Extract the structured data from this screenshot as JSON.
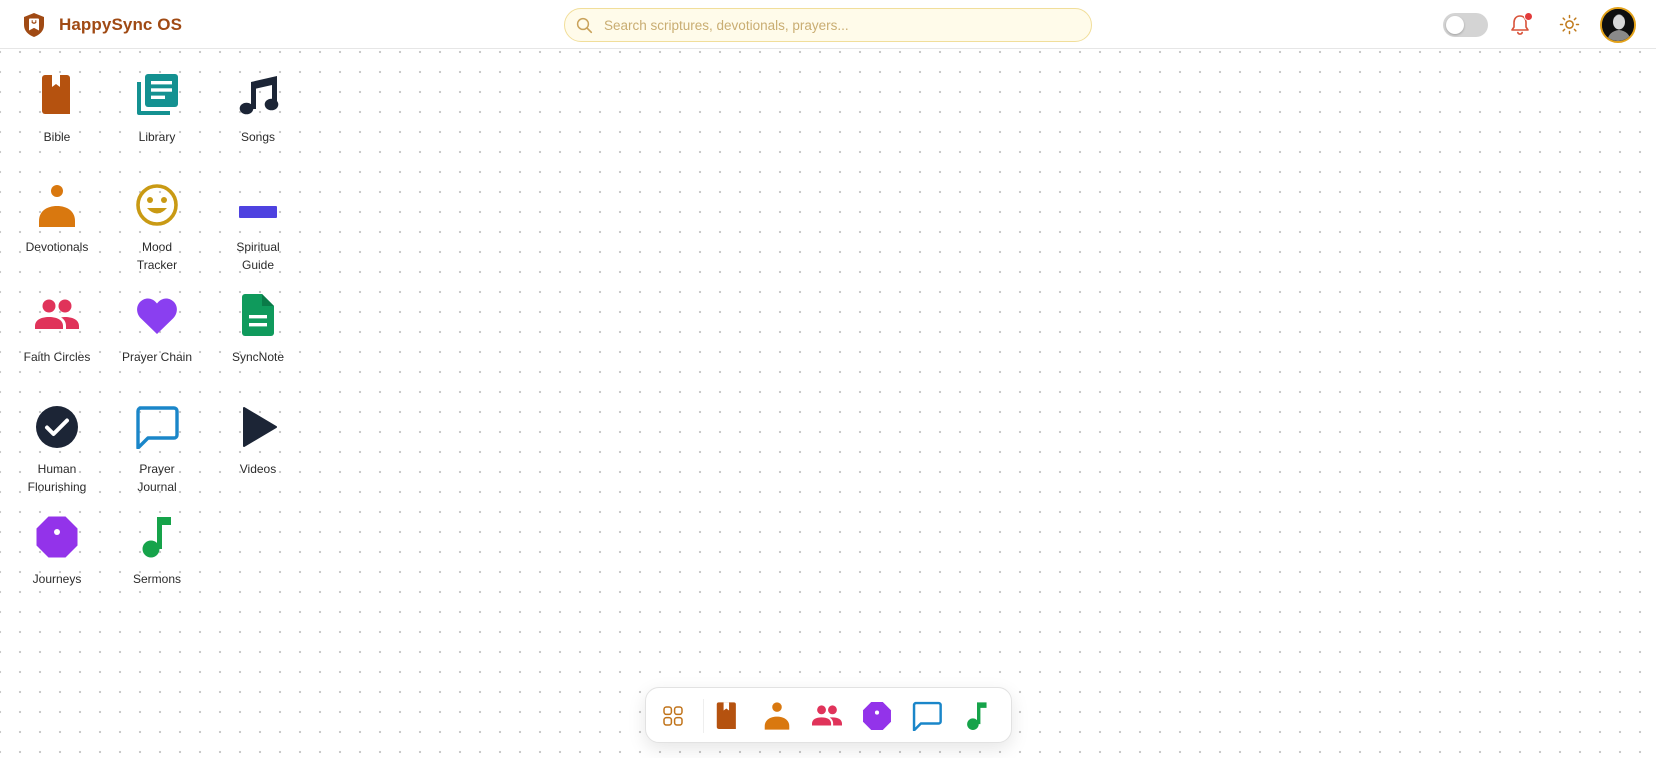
{
  "header": {
    "title": "HappySync OS",
    "search_placeholder": "Search scriptures, devotionals, prayers...",
    "notification_badge": true
  },
  "colors": {
    "brand": "#a04a14",
    "bible": "#b5520f",
    "library": "#149191",
    "songs": "#1c2536",
    "devotionals": "#d9780f",
    "mood": "#c99a14",
    "spiritual_guide": "#4e42e0",
    "faith_circles": "#e0335a",
    "prayer_chain": "#8a3ff0",
    "syncnote": "#0f9a5c",
    "human_flourishing": "#1c2536",
    "prayer_journal": "#1a86c9",
    "videos": "#1c2536",
    "journeys": "#9333ea",
    "sermons": "#16a34a"
  },
  "apps": [
    {
      "id": "bible",
      "label": "Bible",
      "icon": "book-icon"
    },
    {
      "id": "library",
      "label": "Library",
      "icon": "library-icon"
    },
    {
      "id": "songs",
      "label": "Songs",
      "icon": "music-note-icon"
    },
    {
      "id": "devotionals",
      "label": "Devotionals",
      "icon": "person-icon"
    },
    {
      "id": "mood-tracker",
      "label": "Mood\nTracker",
      "icon": "smiley-icon"
    },
    {
      "id": "spiritual-guide",
      "label": "Spiritual\nGuide",
      "icon": "minus-bar-icon"
    },
    {
      "id": "faith-circles",
      "label": "Faith Circles",
      "icon": "people-icon"
    },
    {
      "id": "prayer-chain",
      "label": "Prayer Chain",
      "icon": "heart-icon"
    },
    {
      "id": "syncnote",
      "label": "SyncNote",
      "icon": "document-icon"
    },
    {
      "id": "human-flourishing",
      "label": "Human\nFlourishing",
      "icon": "check-circle-icon"
    },
    {
      "id": "prayer-journal",
      "label": "Prayer\nJournal",
      "icon": "chat-bubble-icon"
    },
    {
      "id": "videos",
      "label": "Videos",
      "icon": "play-icon"
    },
    {
      "id": "journeys",
      "label": "Journeys",
      "icon": "octagon-icon"
    },
    {
      "id": "sermons",
      "label": "Sermons",
      "icon": "single-note-icon"
    }
  ],
  "dock": {
    "items": [
      "apps-grid-icon",
      "book-icon",
      "person-icon",
      "people-icon",
      "octagon-icon",
      "chat-bubble-icon",
      "single-note-icon"
    ]
  }
}
